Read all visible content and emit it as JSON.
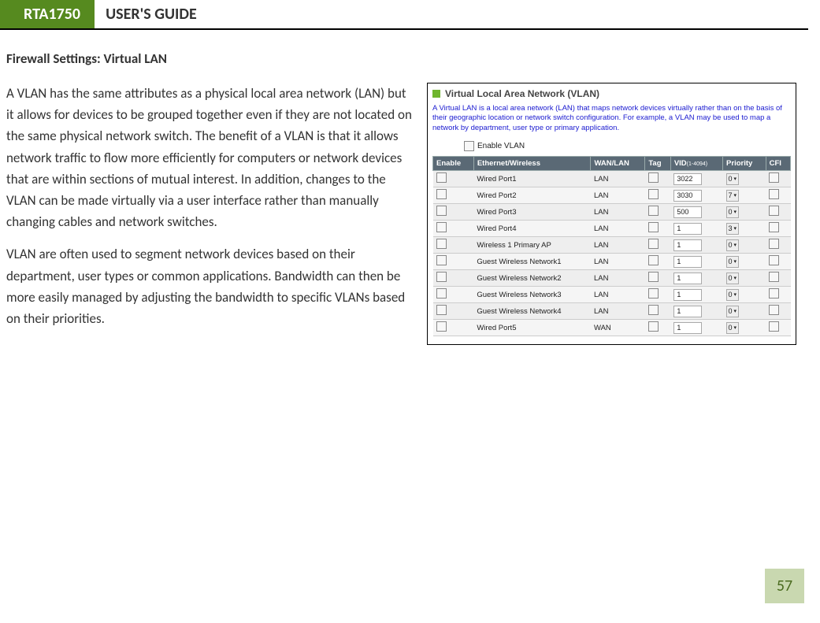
{
  "header": {
    "model": "RTA1750",
    "title": "USER'S GUIDE"
  },
  "section_title": "Firewall Settings: Virtual LAN",
  "para1": "A VLAN has the same attributes as a physical local area network (LAN) but it allows for devices to be grouped together even if they are not located on the same physical network switch.  The benefit of a VLAN is that it allows network traffic to flow more efficiently for computers or network devices that are within sections of mutual interest.  In addition, changes to the VLAN can be made virtually via a user interface rather than manually changing cables and network switches.",
  "para2": "VLAN are often used to segment network devices based on their department, user types or common applications.  Bandwidth can then be more easily managed by adjusting the bandwidth to specific VLANs based on their priorities.",
  "screenshot": {
    "title": "Virtual Local Area Network (VLAN)",
    "desc": "A Virtual LAN is a local area network (LAN) that maps network devices virtually rather than on the basis of their geographic location or network switch configuration. For example, a VLAN may be used to map a network by department, user type or primary application.",
    "enable_label": "Enable VLAN",
    "headers": {
      "enable": "Enable",
      "eth": "Ethernet/Wireless",
      "wanlan": "WAN/LAN",
      "tag": "Tag",
      "vid": "VID",
      "vidrange": "(1-4094)",
      "priority": "Priority",
      "cfi": "CFI"
    },
    "rows": [
      {
        "name": "Wired Port1",
        "wl": "LAN",
        "vid": "3022",
        "prio": "0"
      },
      {
        "name": "Wired Port2",
        "wl": "LAN",
        "vid": "3030",
        "prio": "7"
      },
      {
        "name": "Wired Port3",
        "wl": "LAN",
        "vid": "500",
        "prio": "0"
      },
      {
        "name": "Wired Port4",
        "wl": "LAN",
        "vid": "1",
        "prio": "3"
      },
      {
        "name": "Wireless 1 Primary AP",
        "wl": "LAN",
        "vid": "1",
        "prio": "0"
      },
      {
        "name": "Guest Wireless Network1",
        "wl": "LAN",
        "vid": "1",
        "prio": "0"
      },
      {
        "name": "Guest Wireless Network2",
        "wl": "LAN",
        "vid": "1",
        "prio": "0"
      },
      {
        "name": "Guest Wireless Network3",
        "wl": "LAN",
        "vid": "1",
        "prio": "0"
      },
      {
        "name": "Guest Wireless Network4",
        "wl": "LAN",
        "vid": "1",
        "prio": "0"
      },
      {
        "name": "Wired Port5",
        "wl": "WAN",
        "vid": "1",
        "prio": "0"
      }
    ]
  },
  "page_number": "57"
}
